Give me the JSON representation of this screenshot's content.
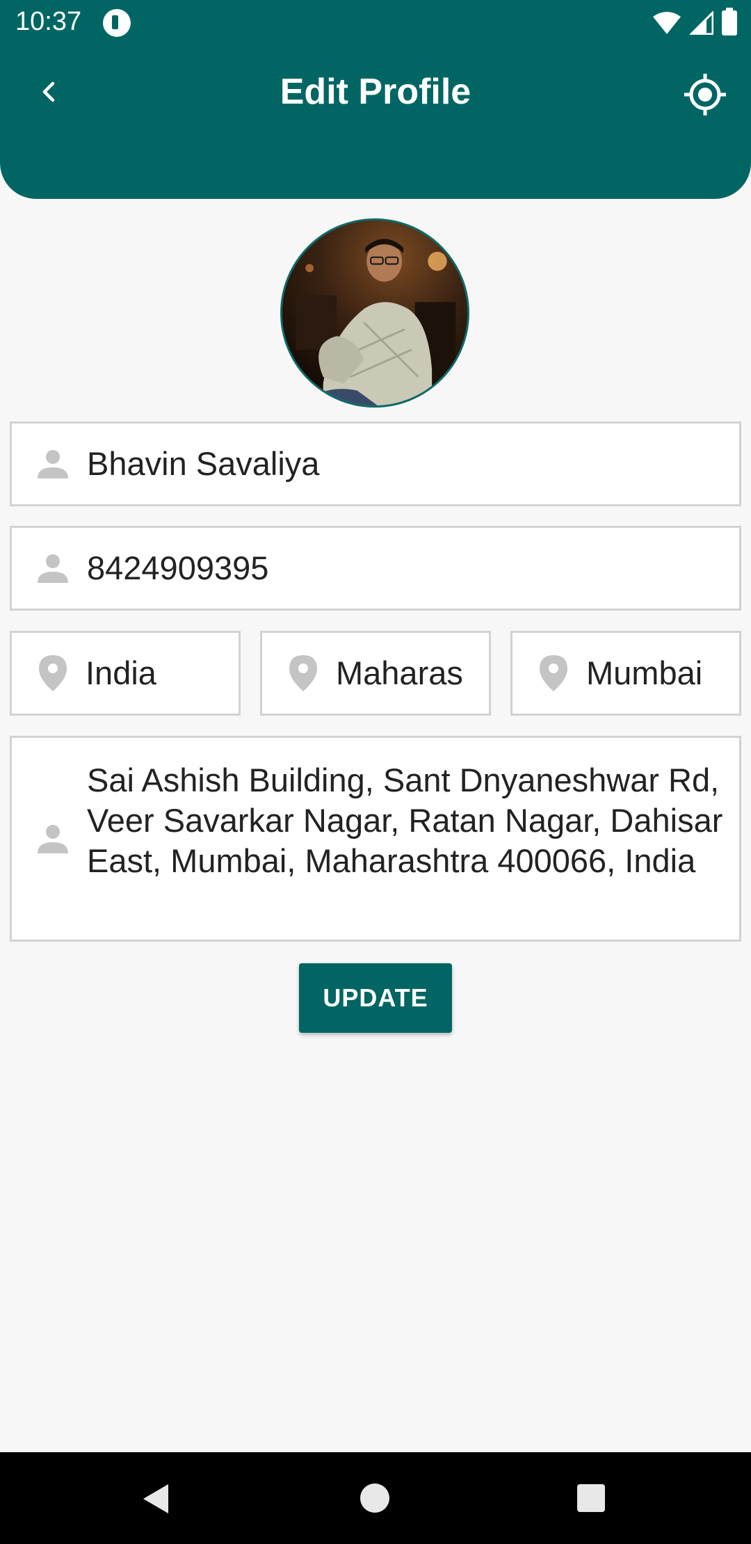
{
  "status_bar": {
    "time": "10:37"
  },
  "toolbar": {
    "title": "Edit Profile",
    "back_icon": "chevron-left-icon",
    "locate_icon": "gps-target-icon"
  },
  "profile": {
    "avatar_alt": "profile photo"
  },
  "form": {
    "name": "Bhavin Savaliya",
    "phone": "8424909395",
    "country": "India",
    "state": "Maharas",
    "city": "Mumbai",
    "address": "Sai Ashish Building, Sant Dnyaneshwar Rd, Veer Savarkar Nagar, Ratan Nagar, Dahisar East, Mumbai, Maharashtra 400066, India"
  },
  "actions": {
    "update_label": "UPDATE"
  },
  "colors": {
    "primary": "#016663",
    "field_border": "#d2d2d2",
    "icon_gray": "#c4c4c4"
  }
}
